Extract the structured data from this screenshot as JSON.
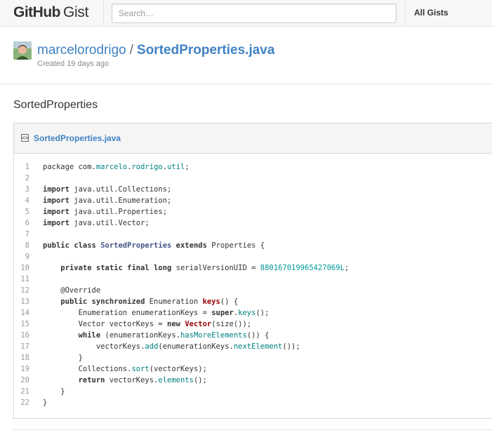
{
  "header": {
    "logo_github": "GitHub",
    "logo_gist": "Gist",
    "search_placeholder": "Search…",
    "all_gists": "All Gists"
  },
  "gist": {
    "owner": "marcelorodrigo",
    "separator": "/",
    "name": "SortedProperties.java",
    "created": "Created 19 days ago",
    "description": "SortedProperties"
  },
  "file": {
    "name": "SortedProperties.java",
    "icon": "code-file-icon"
  },
  "code_lines": [
    [
      {
        "t": "package",
        "c": "plain"
      },
      {
        "t": " com.",
        "c": "plain"
      },
      {
        "t": "marcelo",
        "c": "pkg"
      },
      {
        "t": ".",
        "c": "plain"
      },
      {
        "t": "rodrigo",
        "c": "pkg"
      },
      {
        "t": ".",
        "c": "plain"
      },
      {
        "t": "util",
        "c": "pkg"
      },
      {
        "t": ";",
        "c": "plain"
      }
    ],
    [],
    [
      {
        "t": "import",
        "c": "kw"
      },
      {
        "t": " java.util.Collections;",
        "c": "plain"
      }
    ],
    [
      {
        "t": "import",
        "c": "kw"
      },
      {
        "t": " java.util.Enumeration;",
        "c": "plain"
      }
    ],
    [
      {
        "t": "import",
        "c": "kw"
      },
      {
        "t": " java.util.Properties;",
        "c": "plain"
      }
    ],
    [
      {
        "t": "import",
        "c": "kw"
      },
      {
        "t": " java.util.Vector;",
        "c": "plain"
      }
    ],
    [],
    [
      {
        "t": "public class",
        "c": "kw"
      },
      {
        "t": " ",
        "c": "plain"
      },
      {
        "t": "SortedProperties",
        "c": "cls"
      },
      {
        "t": " ",
        "c": "plain"
      },
      {
        "t": "extends",
        "c": "kw"
      },
      {
        "t": " Properties {",
        "c": "plain"
      }
    ],
    [],
    [
      {
        "t": "    ",
        "c": "plain"
      },
      {
        "t": "private static final long",
        "c": "kw"
      },
      {
        "t": " serialVersionUID = ",
        "c": "plain"
      },
      {
        "t": "880167019965427069L",
        "c": "num"
      },
      {
        "t": ";",
        "c": "plain"
      }
    ],
    [],
    [
      {
        "t": "    @Override",
        "c": "plain"
      }
    ],
    [
      {
        "t": "    ",
        "c": "plain"
      },
      {
        "t": "public synchronized",
        "c": "kw"
      },
      {
        "t": " Enumeration ",
        "c": "plain"
      },
      {
        "t": "keys",
        "c": "fn"
      },
      {
        "t": "() {",
        "c": "plain"
      }
    ],
    [
      {
        "t": "        Enumeration enumerationKeys = ",
        "c": "plain"
      },
      {
        "t": "super",
        "c": "kw"
      },
      {
        "t": ".",
        "c": "plain"
      },
      {
        "t": "keys",
        "c": "mth"
      },
      {
        "t": "();",
        "c": "plain"
      }
    ],
    [
      {
        "t": "        Vector vectorKeys = ",
        "c": "plain"
      },
      {
        "t": "new",
        "c": "kw"
      },
      {
        "t": " ",
        "c": "plain"
      },
      {
        "t": "Vector",
        "c": "fn"
      },
      {
        "t": "(size());",
        "c": "plain"
      }
    ],
    [
      {
        "t": "        ",
        "c": "plain"
      },
      {
        "t": "while",
        "c": "kw"
      },
      {
        "t": " (enumerationKeys.",
        "c": "plain"
      },
      {
        "t": "hasMoreElements",
        "c": "mth"
      },
      {
        "t": "()) {",
        "c": "plain"
      }
    ],
    [
      {
        "t": "            vectorKeys.",
        "c": "plain"
      },
      {
        "t": "add",
        "c": "mth"
      },
      {
        "t": "(enumerationKeys.",
        "c": "plain"
      },
      {
        "t": "nextElement",
        "c": "mth"
      },
      {
        "t": "());",
        "c": "plain"
      }
    ],
    [
      {
        "t": "        }",
        "c": "plain"
      }
    ],
    [
      {
        "t": "        Collections.",
        "c": "plain"
      },
      {
        "t": "sort",
        "c": "mth"
      },
      {
        "t": "(vectorKeys);",
        "c": "plain"
      }
    ],
    [
      {
        "t": "        ",
        "c": "plain"
      },
      {
        "t": "return",
        "c": "kw"
      },
      {
        "t": " vectorKeys.",
        "c": "plain"
      },
      {
        "t": "elements",
        "c": "mth"
      },
      {
        "t": "();",
        "c": "plain"
      }
    ],
    [
      {
        "t": "    }",
        "c": "plain"
      }
    ],
    [
      {
        "t": "}",
        "c": "plain"
      }
    ]
  ]
}
